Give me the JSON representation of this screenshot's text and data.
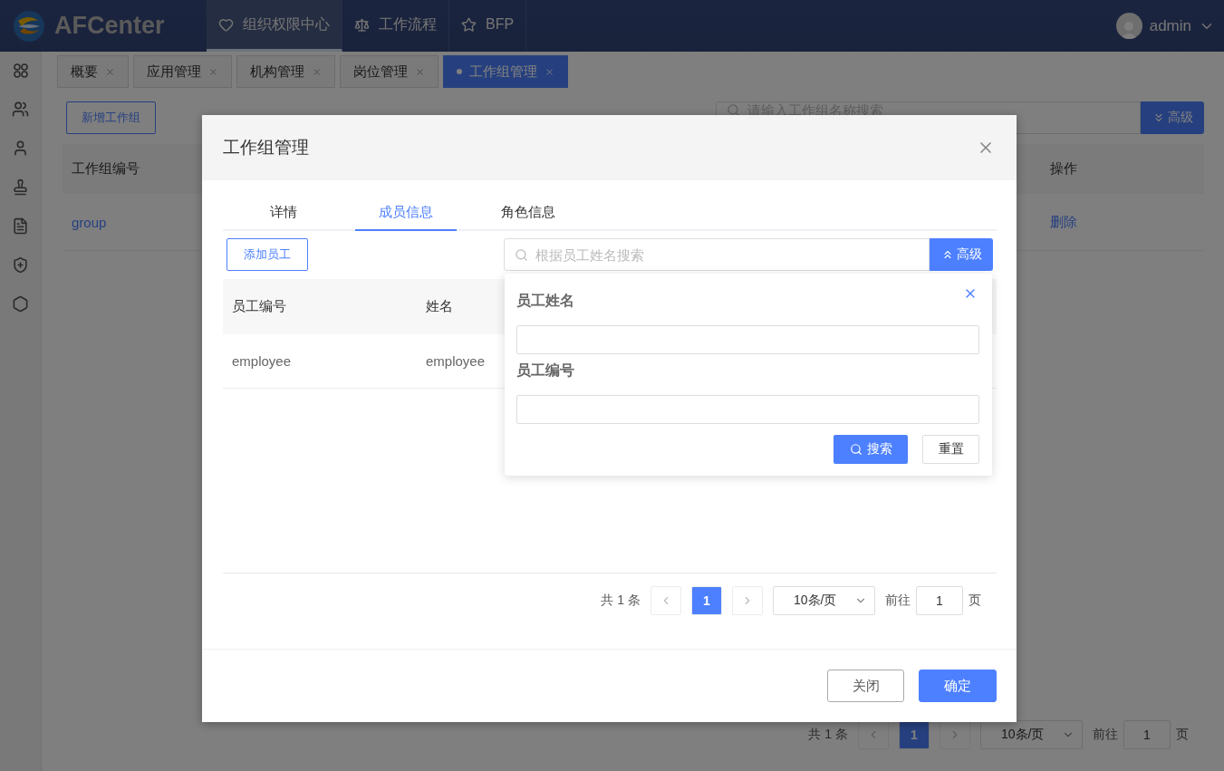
{
  "header": {
    "logo": "AFCenter",
    "nav": [
      {
        "label": "组织权限中心",
        "selected": true
      },
      {
        "label": "工作流程",
        "selected": false
      },
      {
        "label": "BFP",
        "selected": false
      }
    ],
    "user": "admin"
  },
  "tabs": [
    {
      "label": "概要",
      "selected": false
    },
    {
      "label": "应用管理",
      "selected": false
    },
    {
      "label": "机构管理",
      "selected": false
    },
    {
      "label": "岗位管理",
      "selected": false
    },
    {
      "label": "工作组管理",
      "selected": true
    }
  ],
  "page": {
    "add_button": "新增工作组",
    "search": {
      "placeholder": "请输入工作组名称搜索"
    },
    "advanced_button": {
      "label": "高级",
      "expanded": false
    },
    "table": {
      "columns": [
        "工作组编号",
        "操作"
      ],
      "rows": [
        {
          "cells": [
            "group",
            "删除"
          ]
        }
      ]
    },
    "pagination": {
      "total": "共 1 条",
      "pages": [
        {
          "label": "1",
          "selected": true
        }
      ],
      "page_size": "10条/页",
      "goto_label": "前往",
      "goto_value": "1",
      "page_unit": "页"
    }
  },
  "modal": {
    "title": "工作组管理",
    "tabs": [
      {
        "label": "详情",
        "selected": false
      },
      {
        "label": "成员信息",
        "selected": true
      },
      {
        "label": "角色信息",
        "selected": false
      }
    ],
    "add_button": "添加员工",
    "search": {
      "placeholder": "根据员工姓名搜索"
    },
    "advanced_button": {
      "label": "高级",
      "expanded": true
    },
    "advanced_panel": {
      "fields": [
        {
          "label": "员工姓名"
        },
        {
          "label": "员工编号"
        }
      ],
      "search_button": "搜索",
      "reset_button": "重置"
    },
    "table": {
      "columns": [
        "员工编号",
        "姓名"
      ],
      "rows": [
        {
          "cells": [
            "employee",
            "employee"
          ]
        }
      ]
    },
    "pagination": {
      "total": "共 1 条",
      "pages": [
        {
          "label": "1",
          "selected": true
        }
      ],
      "page_size": "10条/页",
      "goto_label": "前往",
      "goto_value": "1",
      "page_unit": "页"
    },
    "buttons": [
      {
        "label": "关闭",
        "kind": "default"
      },
      {
        "label": "确定",
        "kind": "primary"
      }
    ]
  }
}
